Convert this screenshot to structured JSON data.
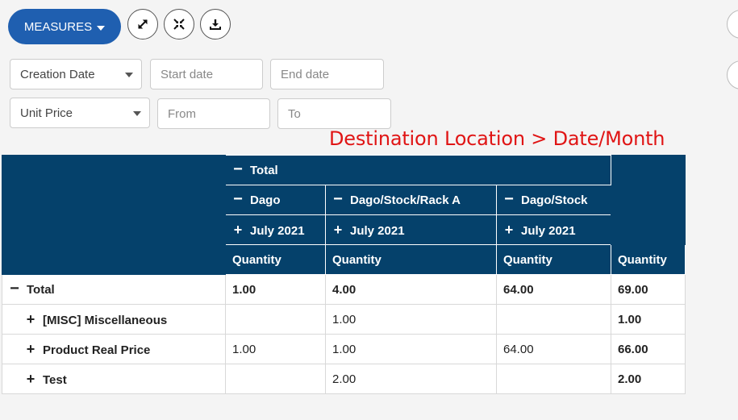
{
  "toolbar": {
    "measures_label": "MEASURES",
    "icons": [
      "expand-icon",
      "collapse-icon",
      "download-icon"
    ]
  },
  "filters": {
    "creation_date": {
      "selected": "Creation Date",
      "start_placeholder": "Start date",
      "end_placeholder": "End date"
    },
    "unit_price": {
      "selected": "Unit Price",
      "from_placeholder": "From",
      "to_placeholder": "To"
    }
  },
  "annotation": "Destination Location > Date/Month",
  "colors": {
    "header_bg": "#05416b",
    "measures_btn": "#1f5fb0",
    "annotation": "#e01515"
  },
  "pivot": {
    "header": {
      "total": "Total",
      "locations": [
        "Dago",
        "Dago/Stock/Rack A",
        "Dago/Stock"
      ],
      "months": [
        "July 2021",
        "July 2021",
        "July 2021"
      ],
      "measure": "Quantity"
    },
    "rows": [
      {
        "label": "Total",
        "values": [
          "1.00",
          "4.00",
          "64.00"
        ],
        "total": "69.00"
      },
      {
        "label": "[MISC] Miscellaneous",
        "values": [
          "",
          "1.00",
          ""
        ],
        "total": "1.00"
      },
      {
        "label": "Product Real Price",
        "values": [
          "1.00",
          "1.00",
          "64.00"
        ],
        "total": "66.00"
      },
      {
        "label": "Test",
        "values": [
          "",
          "2.00",
          ""
        ],
        "total": "2.00"
      }
    ]
  }
}
